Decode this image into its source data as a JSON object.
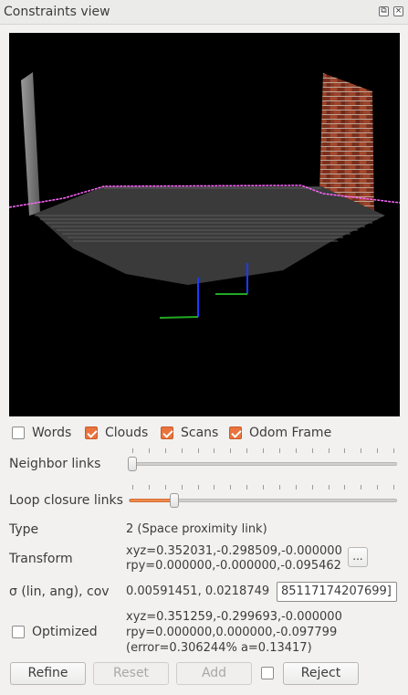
{
  "window": {
    "title": "Constraints view",
    "float_glyph": "⧉",
    "close_glyph": "×"
  },
  "checkboxes": [
    {
      "label": "Words",
      "checked": false
    },
    {
      "label": "Clouds",
      "checked": true
    },
    {
      "label": "Scans",
      "checked": true
    },
    {
      "label": "Odom Frame",
      "checked": true
    }
  ],
  "sliders": {
    "neighbor": {
      "label": "Neighbor links",
      "value_fraction": 0.0
    },
    "loop": {
      "label": "Loop closure links",
      "value_fraction": 0.17
    }
  },
  "info": {
    "type_label": "Type",
    "type_value": "2  (Space proximity link)",
    "transform_label": "Transform",
    "transform_xyz": "xyz=0.352031,-0.298509,-0.000000",
    "transform_rpy": "rpy=0.000000,-0.000000,-0.095462",
    "transform_button": "...",
    "sigma_label": "σ (lin, ang), cov",
    "sigma_value": "0.00591451, 0.0218749",
    "cov_value": "85117174207699]",
    "optimized_label": "Optimized",
    "optimized_checked": false,
    "opt_xyz": "xyz=0.351259,-0.299693,-0.000000",
    "opt_rpy": "rpy=0.000000,0.000000,-0.097799",
    "opt_error": "(error=0.306244% a=0.13417)"
  },
  "buttons": {
    "refine": "Refine",
    "reset": "Reset",
    "add": "Add",
    "reject": "Reject"
  },
  "colors": {
    "accent": "#e9743d",
    "viewport_bg": "#000000",
    "odom_path": "#ff66ff"
  }
}
